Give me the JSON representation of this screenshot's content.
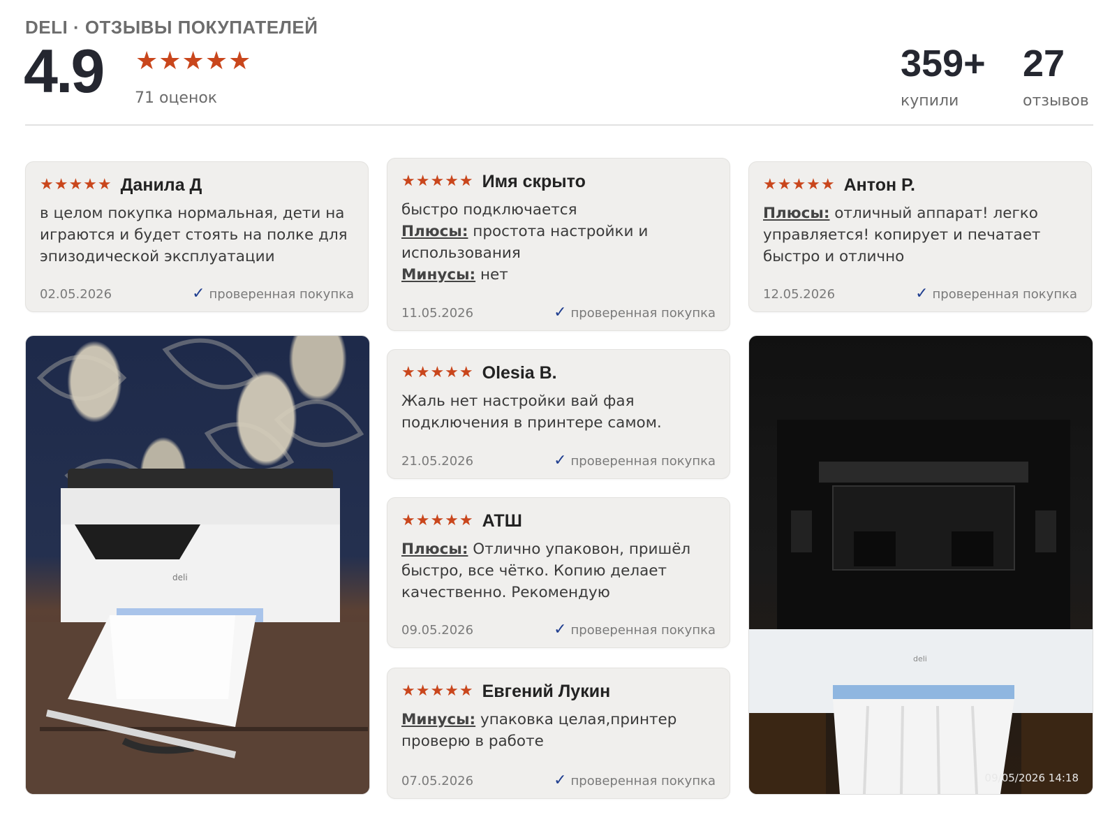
{
  "header": {
    "brand_title": "DELI · ОТЗЫВЫ ПОКУПАТЕЛЕЙ",
    "rating": "4.9",
    "stars": "★★★★★",
    "rating_count": "71 оценок",
    "bought_num": "359+",
    "bought_label": "купили",
    "reviews_num": "27",
    "reviews_label": "отзывов"
  },
  "verified_label": "проверенная покупка",
  "reviews": [
    {
      "stars": "★★★★★",
      "name": "Данила Д",
      "text": "в целом покупка нормальная, дети на играются и будет стоять на полке для эпизодической эксплуатации",
      "date": "02.05.2026"
    },
    {
      "stars": "★★★★★",
      "name": "Имя скрыто",
      "text": "быстро подключается",
      "pros_label": "Плюсы:",
      "pros": "простота настройки и использования",
      "cons_label": "Минусы:",
      "cons": "нет",
      "date": "11.05.2026"
    },
    {
      "stars": "★★★★★",
      "name": "Антон Р.",
      "pros_label": "Плюсы:",
      "pros": "отличный аппарат! легко управляется! копирует и печатает быстро и отлично",
      "date": "12.05.2026"
    },
    {
      "stars": "★★★★★",
      "name": "Olesia B.",
      "text": "Жаль нет настройки вай фая подключения в принтере самом.",
      "date": "21.05.2026"
    },
    {
      "stars": "★★★★★",
      "name": "АТШ",
      "pros_label": "Плюсы:",
      "pros": "Отлично упаковон, пришёл быстро, все чётко. Копию делает качественно. Рекомендую",
      "date": "09.05.2026"
    },
    {
      "stars": "★★★★★",
      "name": "Евгений Лукин",
      "cons_label": "Минусы:",
      "cons": "упаковка целая,принтер проверю в работе",
      "date": "07.05.2026"
    }
  ],
  "photos": {
    "right_timestamp": "09/05/2026 14:18",
    "printer_logo": "deli"
  },
  "colors": {
    "star": "#c9461c",
    "check": "#1e3d8f",
    "card_bg": "#f0efed"
  }
}
